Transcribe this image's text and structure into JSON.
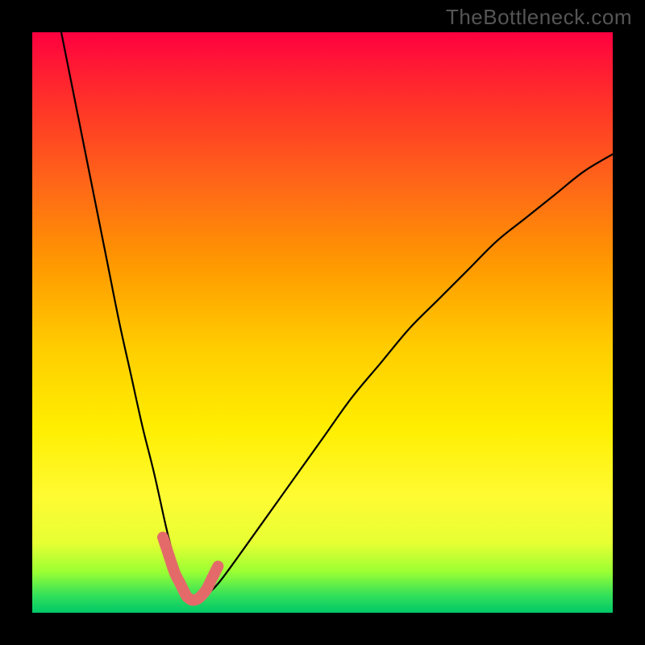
{
  "watermark": "TheBottleneck.com",
  "chart_data": {
    "type": "line",
    "title": "",
    "xlabel": "",
    "ylabel": "",
    "xlim": [
      0,
      100
    ],
    "ylim": [
      0,
      100
    ],
    "series": [
      {
        "name": "black-curve",
        "x": [
          5,
          7,
          9,
          11,
          13,
          15,
          17,
          19,
          21,
          23,
          24,
          25,
          26,
          27,
          28,
          29,
          30,
          32,
          35,
          40,
          45,
          50,
          55,
          60,
          65,
          70,
          75,
          80,
          85,
          90,
          95,
          100
        ],
        "values": [
          100,
          90,
          80,
          70,
          60,
          50,
          41,
          32,
          24,
          15,
          11,
          8,
          5,
          3,
          2,
          2,
          3,
          5,
          9,
          16,
          23,
          30,
          37,
          43,
          49,
          54,
          59,
          64,
          68,
          72,
          76,
          79
        ]
      },
      {
        "name": "red-accent-segment",
        "x": [
          22.5,
          23.5,
          24.5,
          25.5,
          26.5,
          27,
          27.5,
          28,
          28.5,
          29,
          30,
          31,
          32
        ],
        "values": [
          13,
          10,
          7,
          5,
          3,
          2.5,
          2.2,
          2.2,
          2.4,
          2.8,
          4,
          6,
          8
        ]
      }
    ],
    "colors": {
      "black_curve": "#000000",
      "red_accent": "#e46a6a",
      "gradient_top": "#ff0040",
      "gradient_bottom": "#00c868"
    }
  }
}
